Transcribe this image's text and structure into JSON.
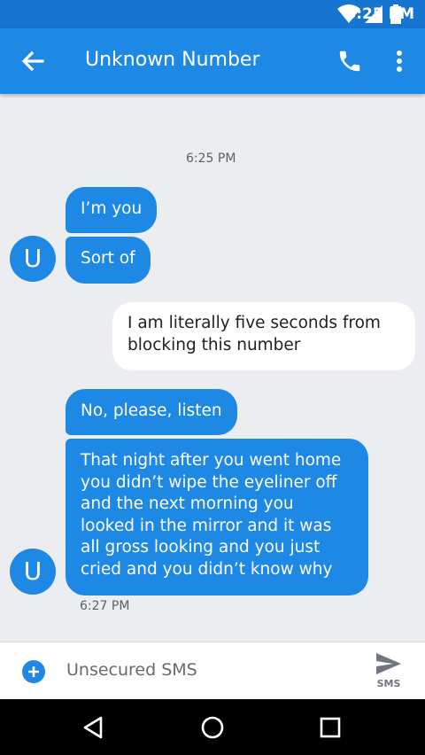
{
  "status_bar": {
    "time": "6:25 PM",
    "icons": [
      "wifi-icon",
      "cell-signal-icon",
      "battery-icon"
    ]
  },
  "app_bar": {
    "title": "Unknown Number",
    "back_icon": "arrow-left-icon",
    "call_icon": "phone-icon",
    "menu_icon": "more-vert-icon"
  },
  "conversation": {
    "timestamp_top": "6:25 PM",
    "avatar_letter": "U",
    "group1": [
      "I’m you",
      "Sort of"
    ],
    "outgoing": [
      "I am literally five seconds from",
      "blocking this number"
    ],
    "group2_first": "No, please, listen",
    "group2_long": [
      "That night after you went home",
      "you didn’t wipe the eyeliner off",
      "and the next morning you",
      "looked in the mirror and it was",
      "all gross looking and you just",
      "cried and you didn’t know why"
    ],
    "timestamp_bottom": "6:27 PM"
  },
  "compose": {
    "placeholder": "Unsecured SMS",
    "send_label": "SMS",
    "add_icon": "add-circle-icon",
    "send_icon": "send-icon"
  },
  "nav_bar": {
    "icons": [
      "back-triangle-icon",
      "home-circle-icon",
      "recents-square-icon"
    ]
  },
  "colors": {
    "accent": "#1e88e5",
    "status_bar": "#1675d1",
    "background": "#ebedf0"
  }
}
